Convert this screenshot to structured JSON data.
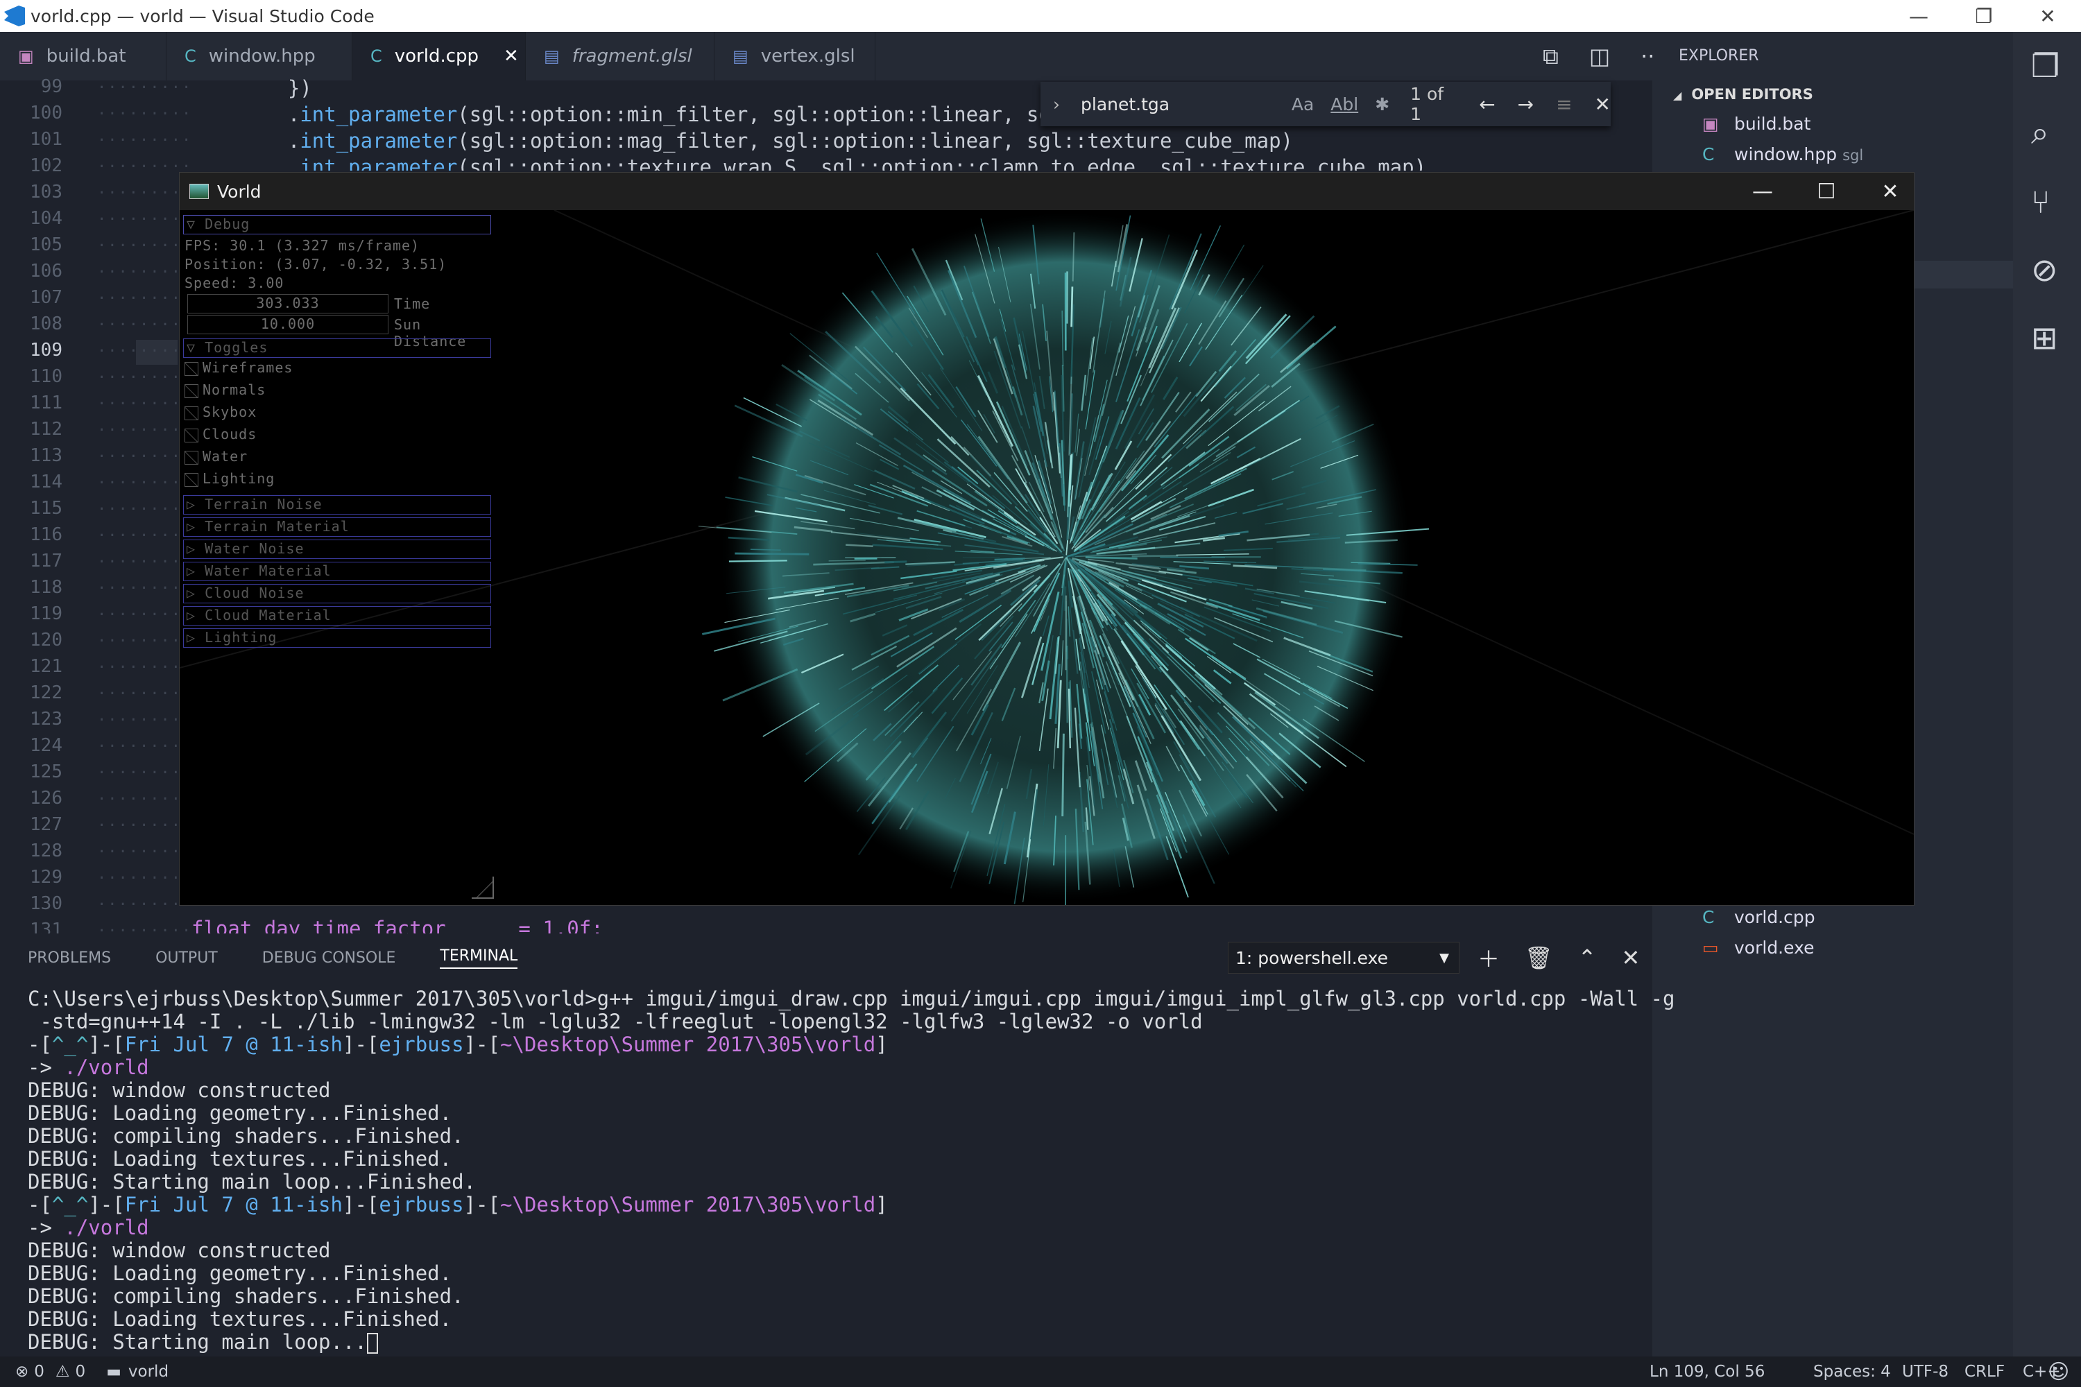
{
  "window": {
    "title": "vorld.cpp — vorld — Visual Studio Code"
  },
  "tabs": [
    {
      "label": "build.bat",
      "icon": "batch-file-icon"
    },
    {
      "label": "window.hpp",
      "icon": "cpp-file-icon"
    },
    {
      "label": "vorld.cpp",
      "icon": "cpp-file-icon",
      "active": true
    },
    {
      "label": "fragment.glsl",
      "icon": "file-icon"
    },
    {
      "label": "vertex.glsl",
      "icon": "file-icon"
    }
  ],
  "editor": {
    "line_numbers": [
      "99",
      "100",
      "101",
      "102",
      "103",
      "104",
      "105",
      "106",
      "107",
      "108",
      "109",
      "110",
      "111",
      "112",
      "113",
      "114",
      "115",
      "116",
      "117",
      "118",
      "119",
      "120",
      "121",
      "122",
      "123",
      "124",
      "125",
      "126",
      "127",
      "128",
      "129",
      "130",
      "131"
    ],
    "code": [
      {
        "pre": "    })",
        "m": "",
        "post": ""
      },
      {
        "pre": "    .",
        "m": "int_parameter",
        "post": "(sgl::option::min_filter, sgl::option::linear, sgl::tex"
      },
      {
        "pre": "    .",
        "m": "int_parameter",
        "post": "(sgl::option::mag_filter, sgl::option::linear, sgl::texture_cube_map)"
      },
      {
        "pre": "    .",
        "m": "int_parameter",
        "post": "(sgl::option::texture_wrap_S, sgl::option::clamp_to_edge, sgl::texture_cube_map)"
      }
    ],
    "bottom_code": "float day_time_factor      = 1.0f;",
    "current_line": "109"
  },
  "find": {
    "query": "planet.tga",
    "match_case": "Aa",
    "whole_word": "Abl",
    "regex": "✱",
    "count": "1 of 1"
  },
  "explorer": {
    "header": "EXPLORER",
    "open_editors": "OPEN EDITORS",
    "files": [
      {
        "label": "build.bat",
        "sub": ""
      },
      {
        "label": "window.hpp",
        "sub": "sgl"
      }
    ],
    "bottom_files": [
      {
        "label": "vorld.cpp"
      },
      {
        "label": "vorld.exe"
      }
    ]
  },
  "vorld_window": {
    "title": "Vorld"
  },
  "imgui": {
    "debug_header": "Debug",
    "fps": "FPS: 30.1 (3.327 ms/frame)",
    "position": "Position: (3.07, -0.32, 3.51)",
    "speed": "Speed: 3.00",
    "time_value": "303.033",
    "time_label": "Time",
    "sun_value": "10.000",
    "sun_label": "Sun Distance",
    "toggles_header": "Toggles",
    "toggles": [
      "Wireframes",
      "Normals",
      "Skybox",
      "Clouds",
      "Water",
      "Lighting"
    ],
    "sections": [
      "Terrain Noise",
      "Terrain Material",
      "Water Noise",
      "Water Material",
      "Cloud Noise",
      "Cloud Material",
      "Lighting"
    ]
  },
  "panel": {
    "tabs": [
      "PROBLEMS",
      "OUTPUT",
      "DEBUG CONSOLE",
      "TERMINAL"
    ],
    "active_tab": "TERMINAL",
    "shell": "1: powershell.exe"
  },
  "terminal": {
    "cmd1": "C:\\Users\\ejrbuss\\Desktop\\Summer 2017\\305\\vorld>g++ imgui/imgui_draw.cpp imgui/imgui.cpp imgui/imgui_impl_glfw_gl3.cpp vorld.cpp -Wall -g",
    "cmd2": " -std=gnu++14 -I . -L ./lib -lmingw32 -lm -lglu32 -lfreeglut -lopengl32 -lglfw3 -lglew32 -o vorld",
    "prompt_face": "^_^",
    "prompt_date": "Fri Jul 7 @ 11-ish",
    "prompt_user": "ejrbuss",
    "prompt_path": "~\\Desktop\\Summer 2017\\305\\vorld",
    "run": "./vorld",
    "debug": [
      "DEBUG: window constructed",
      "DEBUG: Loading geometry...Finished.",
      "DEBUG: compiling shaders...Finished.",
      "DEBUG: Loading textures...Finished.",
      "DEBUG: Starting main loop...Finished."
    ],
    "last_line": "DEBUG: Starting main loop..."
  },
  "status": {
    "errors": "0",
    "warnings": "0",
    "folder": "vorld",
    "position": "Ln 109, Col 56",
    "spaces": "Spaces: 4",
    "encoding": "UTF-8",
    "eol": "CRLF",
    "language": "C++"
  }
}
